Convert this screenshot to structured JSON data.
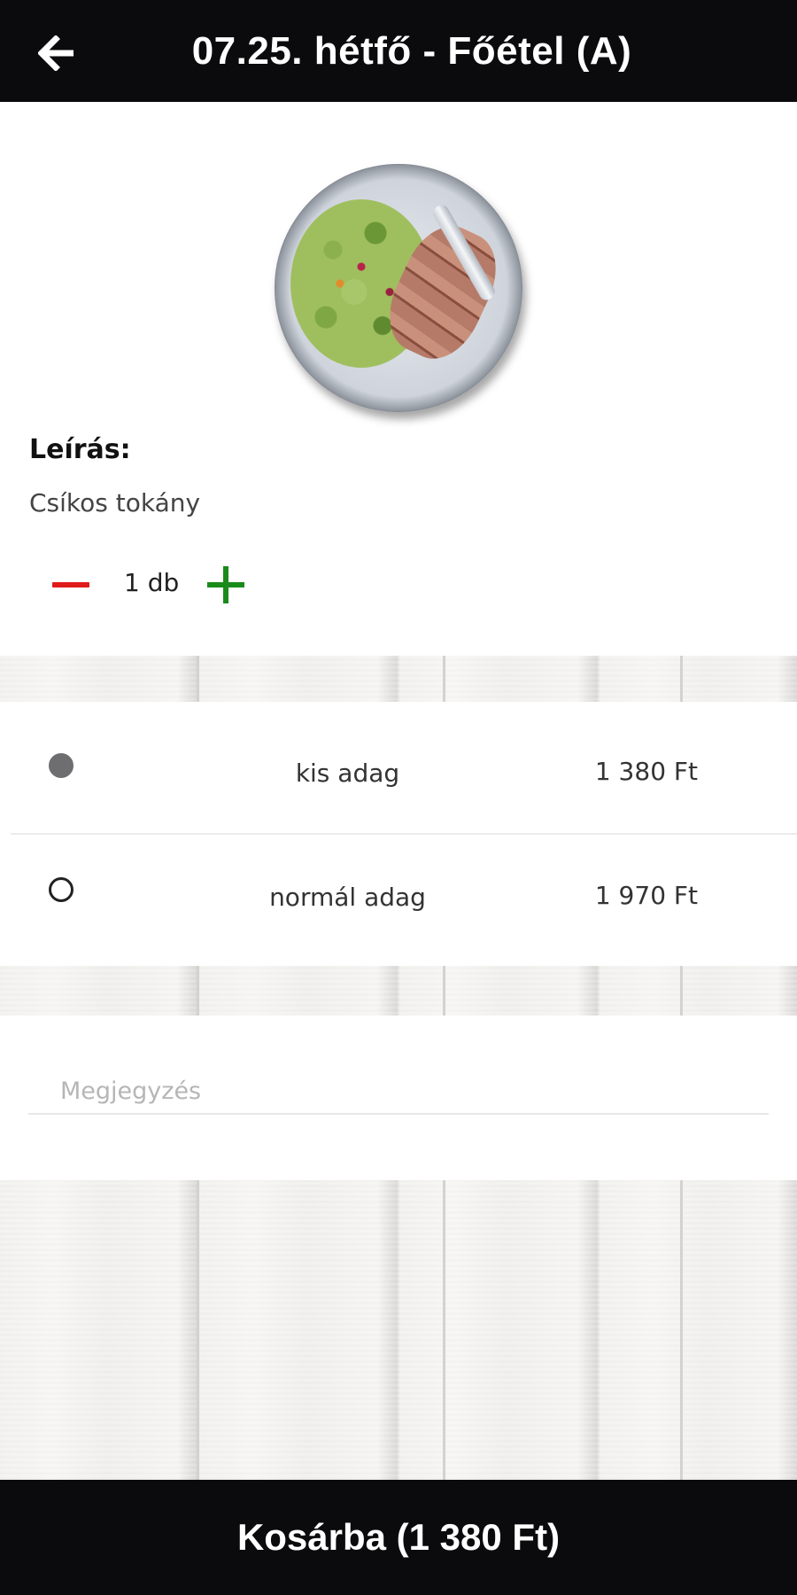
{
  "header": {
    "title": "07.25. hétfő - Főétel (A)",
    "back_icon": "arrow-left-icon"
  },
  "dish": {
    "image_icon": "food-plate-icon",
    "description_label": "Leírás:",
    "description": "Csíkos tokány"
  },
  "quantity": {
    "value": "1 db",
    "minus_icon": "minus-icon",
    "plus_icon": "plus-icon",
    "minus_color": "#e01b1b",
    "plus_color": "#1a8a1a"
  },
  "portions": [
    {
      "name": "kis adag",
      "price": "1 380 Ft",
      "selected": true
    },
    {
      "name": "normál adag",
      "price": "1 970 Ft",
      "selected": false
    }
  ],
  "note": {
    "placeholder": "Megjegyzés",
    "value": ""
  },
  "cart_button": {
    "label": "Kosárba (1 380 Ft)"
  },
  "colors": {
    "bar_background": "#0b0b0d",
    "radio_selected": "#6e6e70"
  }
}
